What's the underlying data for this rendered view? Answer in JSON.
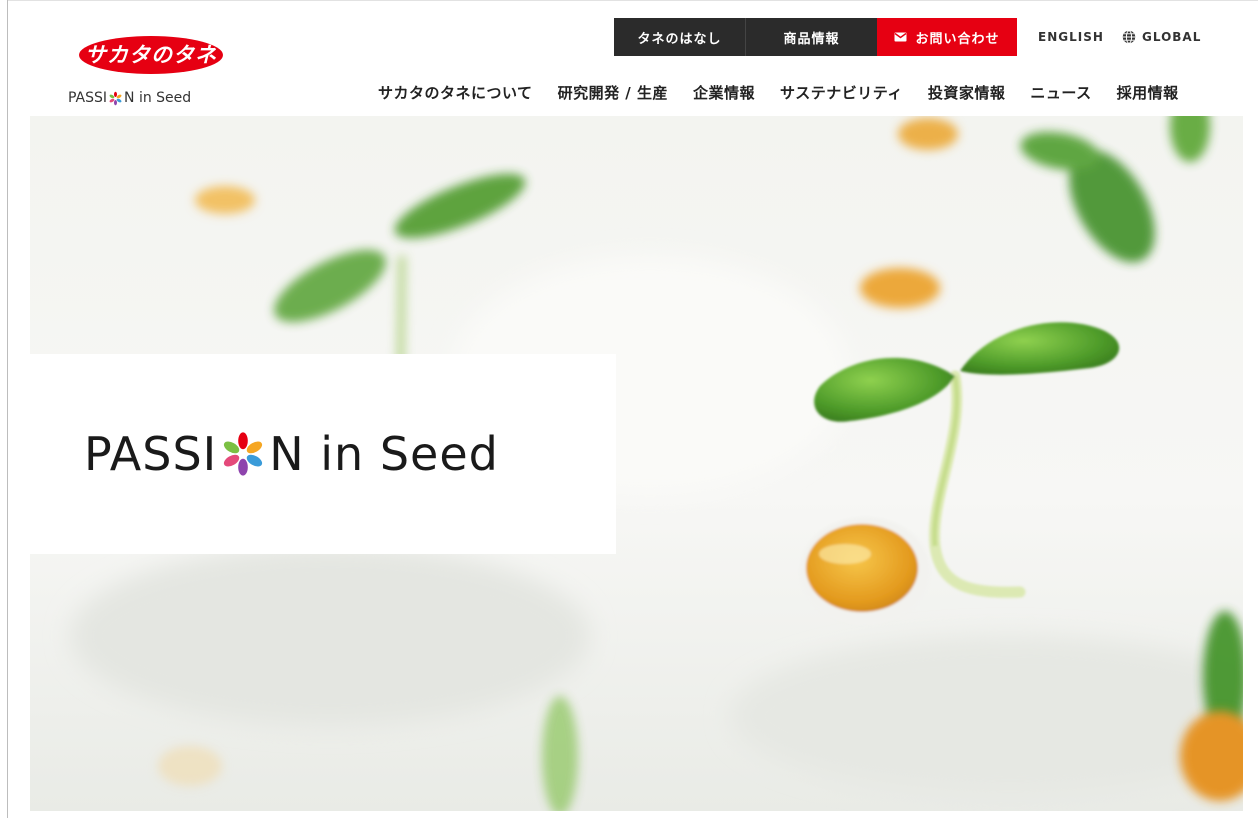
{
  "logo": {
    "name_jp": "サカタのタネ",
    "tagline_before": "PASSI",
    "tagline_after": "N in Seed",
    "brand_red": "#e60012"
  },
  "utility_nav": {
    "seed_story": "タネのはなし",
    "products": "商品情報",
    "contact": "お問い合わせ",
    "english": "ENGLISH",
    "global": "GLOBAL"
  },
  "main_nav": {
    "items": [
      "サカタのタネについて",
      "研究開発 / 生産",
      "企業情報",
      "サステナビリティ",
      "投資家情報",
      "ニュース",
      "採用情報"
    ]
  },
  "hero": {
    "title_before": "PASSI",
    "title_after": "N in Seed",
    "image_subject": "sprouting-seedlings"
  },
  "icons": {
    "mail": "mail-icon",
    "globe": "globe-icon",
    "flower": "flower-icon"
  },
  "colors": {
    "accent_red": "#e60012",
    "dark_button": "#2b2b2b",
    "leaf_green": "#5aa532",
    "seed_orange": "#e9a22a"
  }
}
